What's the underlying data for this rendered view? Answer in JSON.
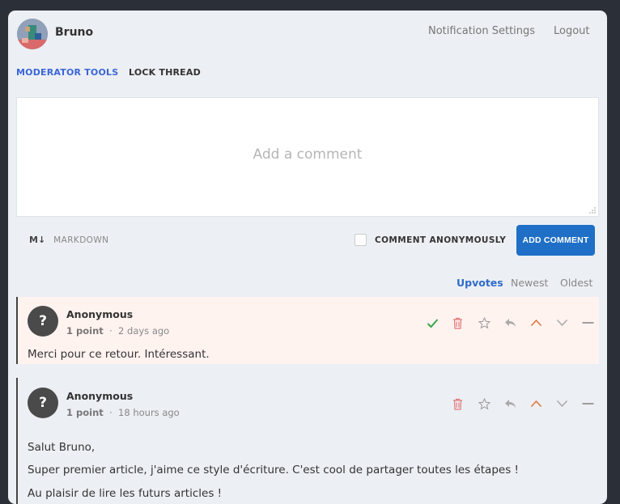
{
  "header": {
    "username": "Bruno",
    "links": [
      "Notification Settings",
      "Logout"
    ]
  },
  "tools": {
    "moderator": "MODERATOR TOOLS",
    "lock": "LOCK THREAD"
  },
  "composer": {
    "placeholder": "Add a comment",
    "markdown_icon": "M↓",
    "markdown_label": "MARKDOWN",
    "anonymous_label": "COMMENT ANONYMOUSLY",
    "anonymous_checked": false,
    "submit_label": "ADD COMMENT"
  },
  "sort": {
    "options": [
      "Upvotes",
      "Newest",
      "Oldest"
    ],
    "selected": "Upvotes"
  },
  "comments": [
    {
      "avatar": "?",
      "author": "Anonymous",
      "points": "1 point",
      "separator": "·",
      "time": "2 days ago",
      "body": [
        "Merci pour ce retour. Intéressant."
      ],
      "icons": [
        "check-icon",
        "trash-icon",
        "star-icon",
        "reply-icon",
        "upvote-icon",
        "downvote-icon",
        "collapse-icon"
      ],
      "highlight_color": "#fff3f0"
    },
    {
      "avatar": "?",
      "author": "Anonymous",
      "points": "1 point",
      "separator": "·",
      "time": "18 hours ago",
      "body": [
        "Salut Bruno,",
        "Super premier article, j'aime ce style d'écriture. C'est cool de partager toutes les étapes !",
        "Au plaisir de lire les futurs articles !"
      ],
      "icons": [
        "trash-icon",
        "star-icon",
        "reply-icon",
        "upvote-icon",
        "downvote-icon",
        "collapse-icon"
      ]
    }
  ],
  "colors": {
    "accent": "#1f6fc6",
    "moderator": "#3a66d8",
    "check": "#3aa54a",
    "trash": "#e27a7a",
    "upvote": "#e0763a"
  }
}
